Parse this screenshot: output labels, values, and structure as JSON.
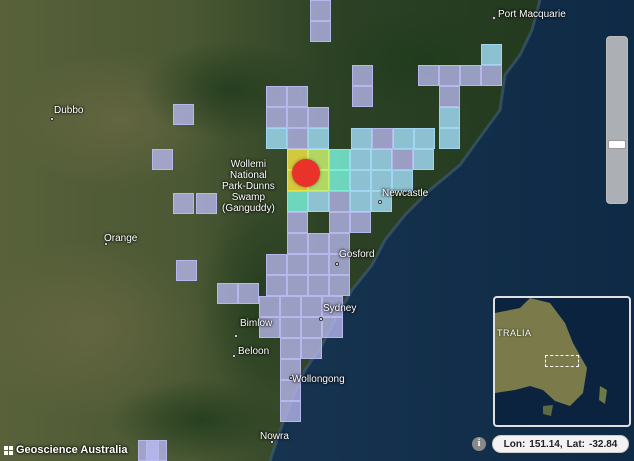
{
  "map": {
    "places": [
      {
        "name": "Port Macquarie"
      },
      {
        "name": "Dubbo"
      },
      {
        "name": "Wollemi\nNational\nPark-Dunns\nSwamp\n(Ganguddy)"
      },
      {
        "name": "Newcastle"
      },
      {
        "name": "Orange"
      },
      {
        "name": "Gosford"
      },
      {
        "name": "Sydney"
      },
      {
        "name": "Bimlow"
      },
      {
        "name": "Beloon"
      },
      {
        "name": "Wollongong"
      },
      {
        "name": "Nowra"
      }
    ],
    "intensity_colors": {
      "low": "#b8b8f0",
      "light": "#9fd8f0",
      "moderate": "#7af0d8",
      "strong": "#c8f070",
      "very_strong": "#f0e040",
      "epicentre": "#e8322a"
    }
  },
  "minimap": {
    "label": "TRALIA"
  },
  "attribution": {
    "text": "Geoscience Australia"
  },
  "info_button": {
    "label": "i"
  },
  "coordinates": {
    "lon_label": "Lon:",
    "lon_value": "151.14,",
    "lat_label": "Lat:",
    "lat_value": "-32.84"
  },
  "icons": {
    "zoom_slider": "zoom-slider",
    "info": "info-icon",
    "attribution": "geoscience-logo-icon"
  }
}
